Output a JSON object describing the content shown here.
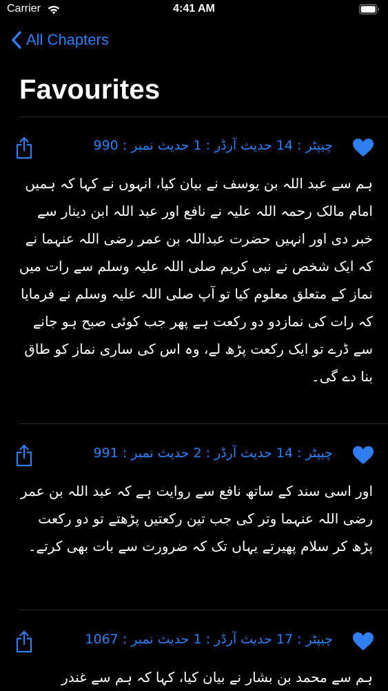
{
  "status_bar": {
    "carrier": "Carrier",
    "time": "4:41 AM"
  },
  "nav": {
    "back_label": "All Chapters"
  },
  "page": {
    "title": "Favourites"
  },
  "colors": {
    "accent": "#2f7ff3",
    "background": "#000000",
    "divider": "#2a2a2c"
  },
  "hadiths": [
    {
      "meta": "چیپٹر : 14 حدیث آرڈر : 1 حدیث نمبر : 990",
      "text": "ہم سے عبد اللہ بن یوسف نے بیان کیا، انہوں نے کہا کہ ہمیں امام مالک رحمہ اللہ علیہ نے نافع اور عبد اللہ ابن دینار سے خبر دی اور انہیں حضرت عبداللہ بن عمر رضی اللہ عنہما نے کہ ایک شخص نے نبی کریم صلی اللہ علیہ وسلم سے رات میں نماز کے متعلق معلوم کیا تو آپ صلی اللہ علیہ وسلم نے فرمایا کہ رات کی نمازدو دو رکعت ہے پھر جب کوئی صبح ہو جانے سے ڈرے تو ایک رکعت پڑھ لے، وہ اس کی ساری نماز کو طاق بنا دے گی۔",
      "favourite": true
    },
    {
      "meta": "چیپٹر : 14 حدیث آرڈر : 2 حدیث نمبر : 991",
      "text": "اور اسی سند کے ساتھ نافع سے روایت ہے کہ عبد اللہ بن عمر رضی اللہ عنہما وتر کی جب تین رکعتیں پڑھتے تو دو رکعت پڑھ کر سلام پھیرتے یہاں تک کہ ضرورت سے بات بھی کرتے۔",
      "favourite": true
    },
    {
      "meta": "چیپٹر : 17 حدیث آرڈر : 1 حدیث نمبر : 1067",
      "text": "ہم سے محمد بن بشار نے بیان کیا، کہا کہ ہم سے غندر",
      "favourite": true
    }
  ],
  "icons": {
    "share": "share-icon",
    "heart": "heart-icon",
    "back": "chevron-left-icon",
    "wifi": "wifi-icon",
    "battery": "battery-icon"
  }
}
